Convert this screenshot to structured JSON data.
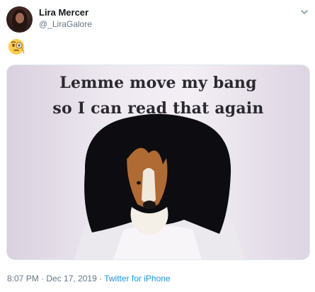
{
  "author": {
    "name": "Lira Mercer",
    "handle": "@_LiraGalore"
  },
  "tweet": {
    "emoji": "🧐"
  },
  "media": {
    "line1": "Lemme move my bang",
    "line2": "so I can read that again"
  },
  "meta": {
    "time": "8:07 PM",
    "separator": " · ",
    "date": "Dec 17, 2019",
    "source": "Twitter for iPhone"
  },
  "icons": {
    "caret": "chevron-down-icon",
    "emoji": "face-with-monocle-icon"
  }
}
